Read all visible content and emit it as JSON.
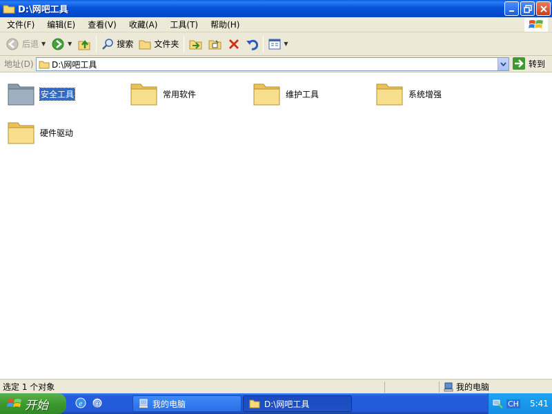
{
  "window": {
    "title": "D:\\网吧工具",
    "buttons": [
      "minimize",
      "maximize",
      "close"
    ]
  },
  "menu": {
    "items": [
      "文件(F)",
      "编辑(E)",
      "查看(V)",
      "收藏(A)",
      "工具(T)",
      "帮助(H)"
    ]
  },
  "toolbar": {
    "back_label": "后退",
    "search_label": "搜索",
    "folders_label": "文件夹"
  },
  "address": {
    "label": "地址(D)",
    "value": "D:\\网吧工具",
    "go_label": "转到"
  },
  "folders": [
    {
      "name": "安全工具",
      "selected": true
    },
    {
      "name": "常用软件",
      "selected": false
    },
    {
      "name": "维护工具",
      "selected": false
    },
    {
      "name": "系统增强",
      "selected": false
    },
    {
      "name": "硬件驱动",
      "selected": false
    }
  ],
  "status": {
    "left": "选定 1 个对象",
    "right": "我的电脑"
  },
  "taskbar": {
    "start_label": "开始",
    "tasks": [
      {
        "label": "我的电脑",
        "active": false
      },
      {
        "label": "D:\\网吧工具",
        "active": true
      }
    ],
    "tray_lang": "CH",
    "tray_time": "5:41"
  },
  "colors": {
    "titlebar": "#0553d8",
    "selection": "#316ac5",
    "chrome": "#ece9d8",
    "folder": "#f5d97e"
  }
}
